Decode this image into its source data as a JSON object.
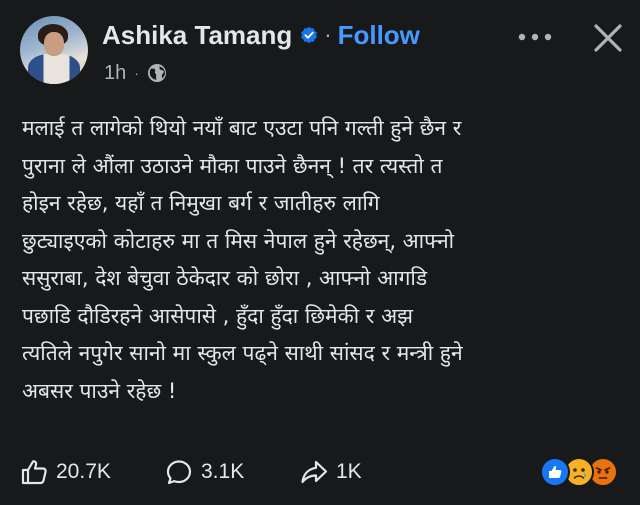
{
  "header": {
    "author_name": "Ashika Tamang",
    "follow_label": "Follow",
    "separator": "·",
    "time": "1h",
    "meta_separator": "·",
    "verified_icon": "verified-badge-icon",
    "privacy_icon": "globe-icon",
    "more_label": "•••"
  },
  "post": {
    "lines": [
      "मलाई त लागेको थियो नयाँ बाट एउटा पनि गल्ती हुने छैन र",
      "पुराना ले औंला उठाउने मौका पाउने छैनन् ! तर त्यस्तो त",
      "होइन रहेछ, यहाँ त निमुखा बर्ग र जातीहरु लागि",
      "छुट्याइएको कोटाहरु मा त मिस नेपाल हुने रहेछन्, आफ्नो",
      "ससुराबा, देश बेचुवा ठेकेदार को छोरा , आफ्नो आगडि",
      "पछाडि दौडिरहने आसेपासे , हुँदा हुँदा छिमेकी र  अझ",
      "त्यतिले नपुगेर सानो मा स्कुल पढ्ने साथी सांसद र मन्त्री हुने",
      "अबसर पाउने रहेछ !"
    ]
  },
  "footer": {
    "likes": "20.7K",
    "comments": "3.1K",
    "shares": "1K",
    "reaction_icons": [
      "like-reaction-icon",
      "sad-reaction-icon",
      "angry-reaction-icon"
    ]
  },
  "colors": {
    "background": "#18191a",
    "text": "#e4e6eb",
    "secondary": "#b0b3b8",
    "accent": "#4599ff"
  }
}
